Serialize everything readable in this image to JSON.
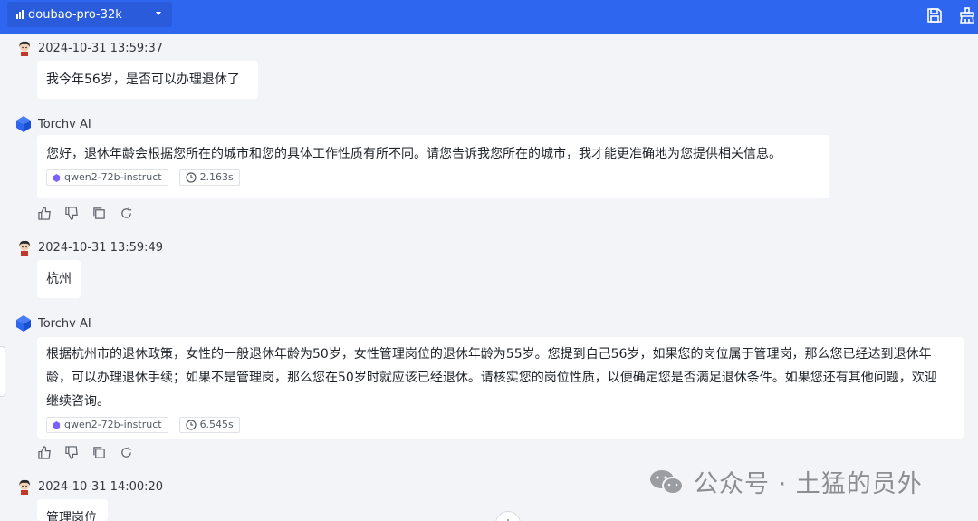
{
  "header": {
    "model_name": "doubao-pro-32k",
    "save_icon": "save-icon",
    "clear_icon": "clear-broom-icon"
  },
  "messages": [
    {
      "role": "user",
      "timestamp": "2024-10-31 13:59:37",
      "text": "我今年56岁，是否可以办理退休了"
    },
    {
      "role": "assistant",
      "sender": "Torchv AI",
      "text": "您好，退休年龄会根据您所在的城市和您的具体工作性质有所不同。请您告诉我您所在的城市，我才能更准确地为您提供相关信息。",
      "model_tag": "qwen2-72b-instruct",
      "duration": "2.163s"
    },
    {
      "role": "user",
      "timestamp": "2024-10-31 13:59:49",
      "text": "杭州"
    },
    {
      "role": "assistant",
      "sender": "Torchv AI",
      "text": "根据杭州市的退休政策，女性的一般退休年龄为50岁，女性管理岗位的退休年龄为55岁。您提到自己56岁，如果您的岗位属于管理岗，那么您已经达到退休年龄，可以办理退休手续；如果不是管理岗，那么您在50岁时就应该已经退休。请核实您的岗位性质，以便确定您是否满足退休条件。如果您还有其他问题，欢迎继续咨询。",
      "model_tag": "qwen2-72b-instruct",
      "duration": "6.545s"
    },
    {
      "role": "user",
      "timestamp": "2024-10-31 14:00:20",
      "text": "管理岗位"
    }
  ],
  "watermark": {
    "text": "公众号 · 土猛的员外"
  },
  "colors": {
    "topbar": "#2f66f0",
    "background": "#f2f4f7",
    "bubble": "#ffffff"
  }
}
